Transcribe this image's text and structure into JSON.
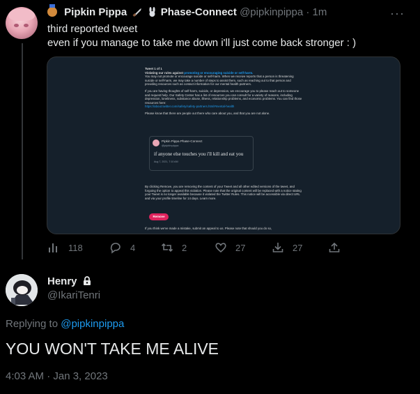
{
  "parent_tweet": {
    "display_name": "Pipkin Pippa",
    "display_name_suffix": "Phase-Connect",
    "handle": "@pipkinpippa",
    "time": "1m",
    "text_line1": "third reported tweet",
    "text_line2": "even if you manage to take me down i'll just come back stronger : )",
    "more_label": "···",
    "screenshot": {
      "heading": "Tweet 1 of 1",
      "violation_prefix": "Violating our rules against",
      "violation_link": "promoting or encouraging suicide or self-harm.",
      "para1": "You may not promote or encourage suicide or self-harm. When we receive reports that a person is threatening suicide or self-harm, we may take a number of steps to assist them, such as reaching out to that person and providing resources such as contact information for our mental health partners.",
      "para2": "If you are having thoughts of self-harm, suicide, or depression, we encourage you to please reach out to someone and request help. Our Safety Center has a list of resources you can consult for a variety of reasons, including depression, loneliness, substance abuse, illness, relationship problems, and economic problems. You can find those resources here:",
      "para2_link": "https://about.twitter.com/safety/safety-partners.html#mental-health",
      "para3": "Please know that there are people out there who care about you, and that you are not alone.",
      "quoted": {
        "name": "Pipkin Pippa",
        "name_suffix": "Phase-Connect",
        "handle": "@pipkinpippa",
        "text": "if anyone else touches you i'll kill and eat you",
        "date": "Aug 7, 2021, 7:10 AM"
      },
      "para4": "By clicking Remove, you are removing the content of your Tweet and all other edited versions of the tweet, and forgoing the option to appeal this violation. Please note that the original content will be replaced with a notice stating your Tweet is no longer available because it violated the Twitter Rules. This notice will be accessible via direct URL and via your profile timeline for 14 days.",
      "para4_link": "Learn more.",
      "remove_label": "Remove",
      "para5": "If you think we've made a mistake, submit an",
      "para5_link": "appeal",
      "para5_rest": "to us. Please note that should you do so,"
    },
    "actions": {
      "views": "118",
      "replies": "4",
      "retweets": "2",
      "likes": "27",
      "bookmarks": "27"
    }
  },
  "reply_tweet": {
    "display_name": "Henry",
    "handle": "@IkariTenri",
    "replying_to_label": "Replying to",
    "replying_to_handle": "@pipkinpippa",
    "text": "YOU WON'T TAKE ME ALIVE",
    "timestamp": "4:03 AM · Jan 3, 2023"
  },
  "colors": {
    "accent": "#1d9bf0",
    "muted": "#71767b",
    "remove": "#e0245e"
  }
}
